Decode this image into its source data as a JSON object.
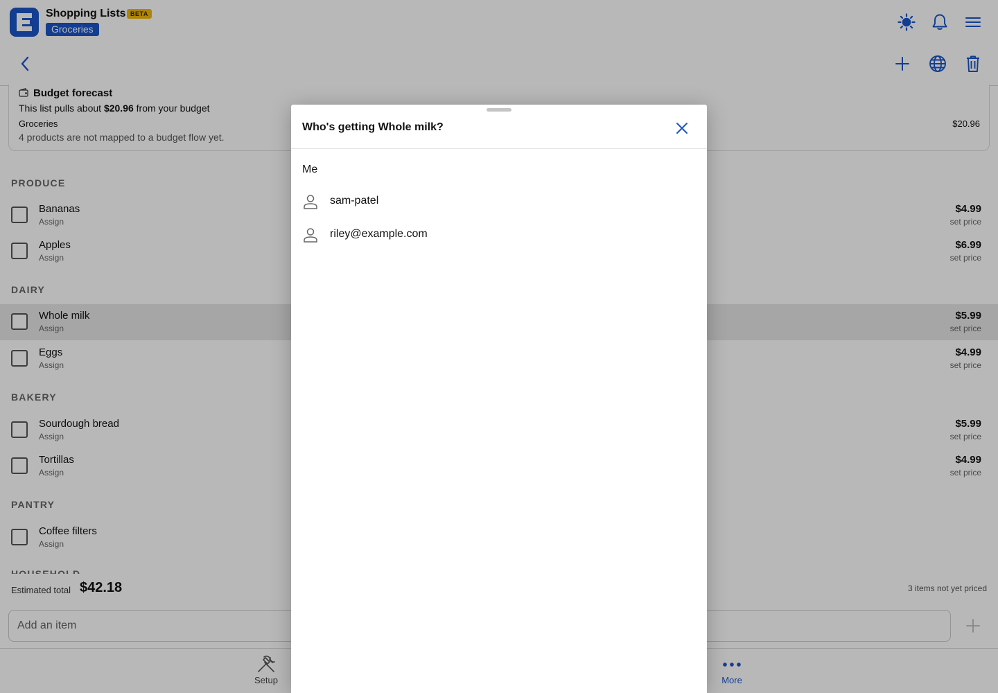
{
  "header": {
    "app_title": "Shopping Lists",
    "beta_badge": "BETA",
    "list_name": "Groceries",
    "icons": [
      "sun-icon",
      "bell-icon",
      "menu-icon",
      "back-icon",
      "add-icon",
      "globe-icon",
      "trash-icon"
    ]
  },
  "budget": {
    "title": "Budget forecast",
    "line_prefix": "This list pulls about ",
    "amount": "$20.96",
    "line_suffix": " from your budget",
    "category": "Groceries",
    "category_amount": "$20.96",
    "note": "4 products are not mapped to a budget flow yet."
  },
  "sections": [
    {
      "name": "PRODUCE",
      "items": [
        {
          "name": "Bananas",
          "assign": "Assign",
          "price": "$4.99",
          "sub": "set price"
        },
        {
          "name": "Apples",
          "assign": "Assign",
          "price": "$6.99",
          "sub": "set price"
        }
      ]
    },
    {
      "name": "DAIRY",
      "items": [
        {
          "name": "Whole milk",
          "assign": "Assign",
          "price": "$5.99",
          "sub": "set price"
        },
        {
          "name": "Eggs",
          "assign": "Assign",
          "price": "$4.99",
          "sub": "set price"
        }
      ]
    },
    {
      "name": "BAKERY",
      "items": [
        {
          "name": "Sourdough bread",
          "assign": "Assign",
          "price": "$5.99",
          "sub": "set price"
        },
        {
          "name": "Tortillas",
          "assign": "Assign",
          "price": "$4.99",
          "sub": "set price"
        }
      ]
    },
    {
      "name": "PANTRY",
      "items": [
        {
          "name": "Coffee filters",
          "assign": "Assign",
          "price": "",
          "sub": ""
        }
      ]
    },
    {
      "name": "HOUSEHOLD",
      "items": []
    }
  ],
  "footer": {
    "estimated_label": "Estimated total",
    "estimated_total": "$42.18",
    "not_priced": "3 items not yet priced",
    "add_placeholder": "Add an item"
  },
  "tabs": [
    {
      "label": "Setup",
      "icon": "tools-icon"
    },
    {
      "label": "More",
      "icon": "more-dots-icon"
    }
  ],
  "sheet": {
    "title": "Who's getting Whole milk?",
    "me_option": "Me",
    "people": [
      "sam-patel",
      "riley@example.com"
    ]
  },
  "colors": {
    "accent": "#1a55c9",
    "beta": "#f0b90b",
    "scrim": "rgba(0,0,0,0.28)"
  }
}
